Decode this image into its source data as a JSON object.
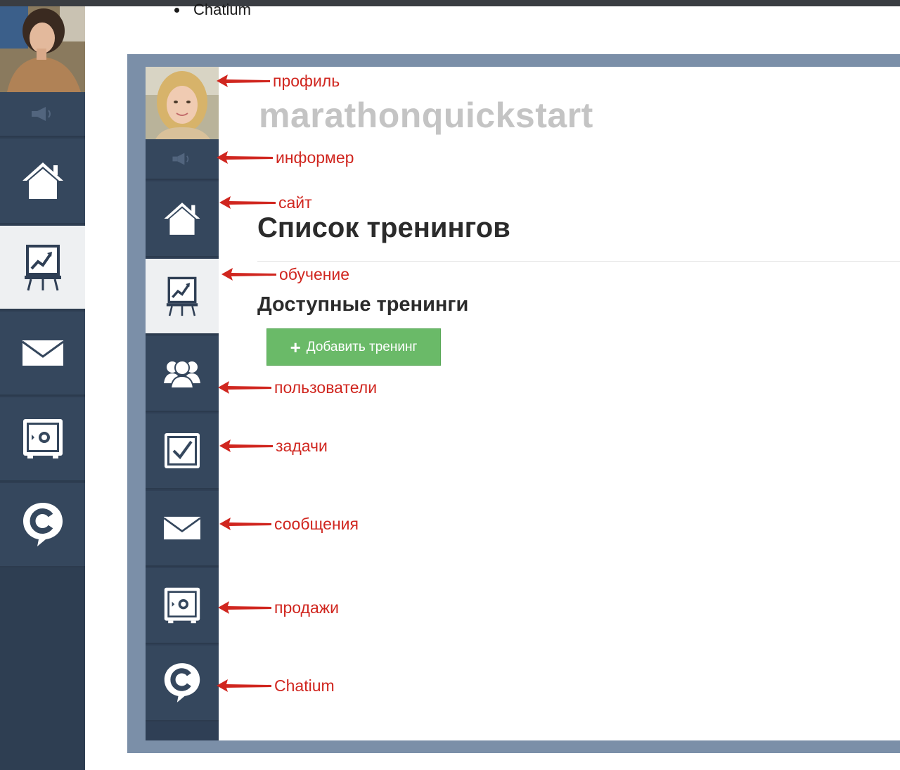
{
  "page": {
    "bullet_text": "Chatium"
  },
  "outer_sidebar": {
    "items": [
      {
        "icon": "speaker-icon",
        "active": false
      },
      {
        "icon": "home-icon",
        "active": false
      },
      {
        "icon": "training-board-icon",
        "active": true
      },
      {
        "icon": "envelope-icon",
        "active": false
      },
      {
        "icon": "safe-icon",
        "active": false
      },
      {
        "icon": "chatium-icon",
        "active": false
      }
    ]
  },
  "screenshot": {
    "brand": "marathonquickstart",
    "page_title": "Список тренингов",
    "section_title": "Доступные тренинги",
    "add_button_label": "Добавить тренинг",
    "add_button_icon": "plus-icon",
    "sidebar_items": [
      {
        "icon": "avatar",
        "annotation": "профиль"
      },
      {
        "icon": "speaker-icon",
        "annotation": "информер"
      },
      {
        "icon": "home-icon",
        "annotation": "сайт"
      },
      {
        "icon": "training-board-icon",
        "annotation": "обучение",
        "active": true
      },
      {
        "icon": "users-icon",
        "annotation": "пользователи"
      },
      {
        "icon": "checkbox-icon",
        "annotation": "задачи"
      },
      {
        "icon": "envelope-icon",
        "annotation": "сообщения"
      },
      {
        "icon": "safe-icon",
        "annotation": "продажи"
      },
      {
        "icon": "chatium-icon",
        "annotation": "Chatium"
      }
    ]
  },
  "colors": {
    "annotation_red": "#d0261f",
    "sidebar_bg": "#35475d",
    "button_green": "#6aba68",
    "frame": "#7b8fa8"
  }
}
